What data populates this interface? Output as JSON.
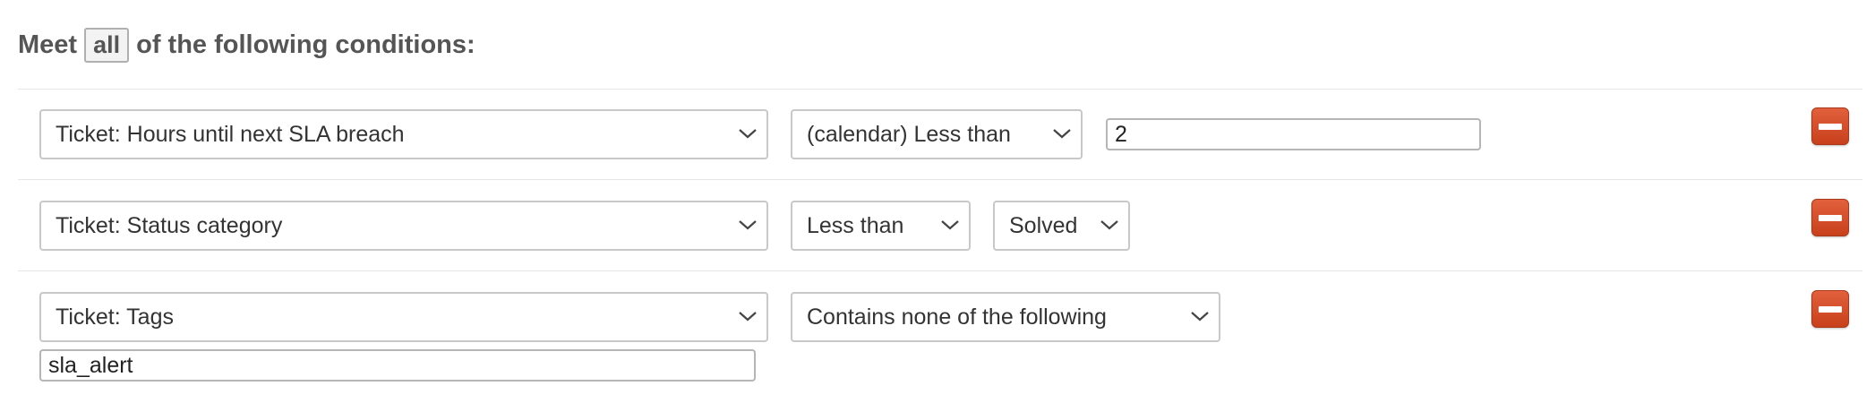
{
  "header": {
    "prefix": "Meet",
    "mode": "all",
    "suffix": "of the following conditions:"
  },
  "conditions": [
    {
      "field": "Ticket: Hours until next SLA breach",
      "operator": "(calendar) Less than",
      "value": "2"
    },
    {
      "field": "Ticket: Status category",
      "operator": "Less than",
      "value": "Solved"
    },
    {
      "field": "Ticket: Tags",
      "operator": "Contains none of the following",
      "value": "sla_alert"
    }
  ],
  "icons": {
    "chevron": "chevron-down-icon",
    "remove": "minus-icon"
  },
  "colors": {
    "remove_button": "#d24f2a",
    "border": "#c8c8c8",
    "heading": "#555555"
  }
}
